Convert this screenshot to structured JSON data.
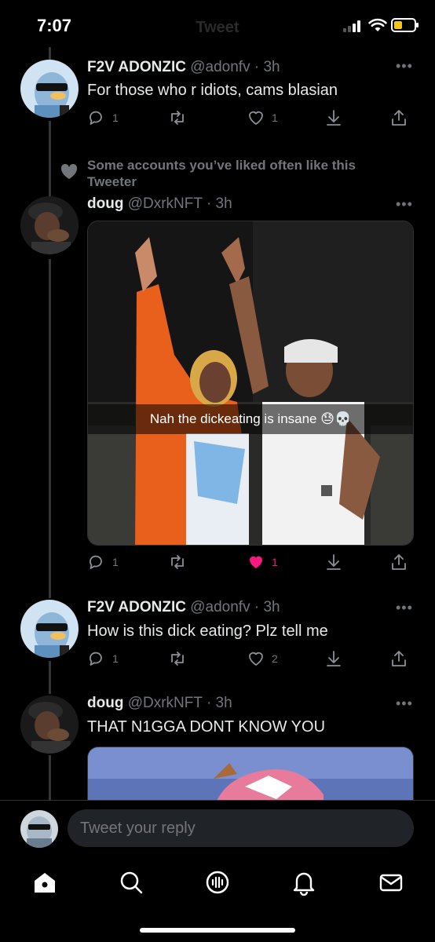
{
  "status_bar": {
    "time": "7:07",
    "title": "Tweet"
  },
  "thread": [
    {
      "name": "F2V ADONZIC",
      "handle": "@adonfv",
      "time": "· 3h",
      "text": "For those who r idiots, cams blasian",
      "replies": "1",
      "retweets": "",
      "likes": "1"
    },
    {
      "social_context": "Some accounts you’ve liked often like this Tweeter",
      "name": "doug",
      "handle": "@DxrkNFT",
      "time": "· 3h",
      "media_caption": "Nah the dickeating is insane 😓💀",
      "replies": "1",
      "retweets": "",
      "likes": "1",
      "liked": true
    },
    {
      "name": "F2V ADONZIC",
      "handle": "@adonfv",
      "time": "· 3h",
      "text": "How is this dick eating? Plz tell me",
      "replies": "1",
      "retweets": "",
      "likes": "2"
    },
    {
      "name": "doug",
      "handle": "@DxrkNFT",
      "time": "· 3h",
      "text": "THAT N1GGA DONT KNOW YOU"
    }
  ],
  "reply": {
    "placeholder": "Tweet your reply"
  },
  "colors": {
    "background": "#000000",
    "text": "#e7e9ea",
    "muted": "#71767b",
    "like": "#f91880",
    "input": "#202327"
  }
}
